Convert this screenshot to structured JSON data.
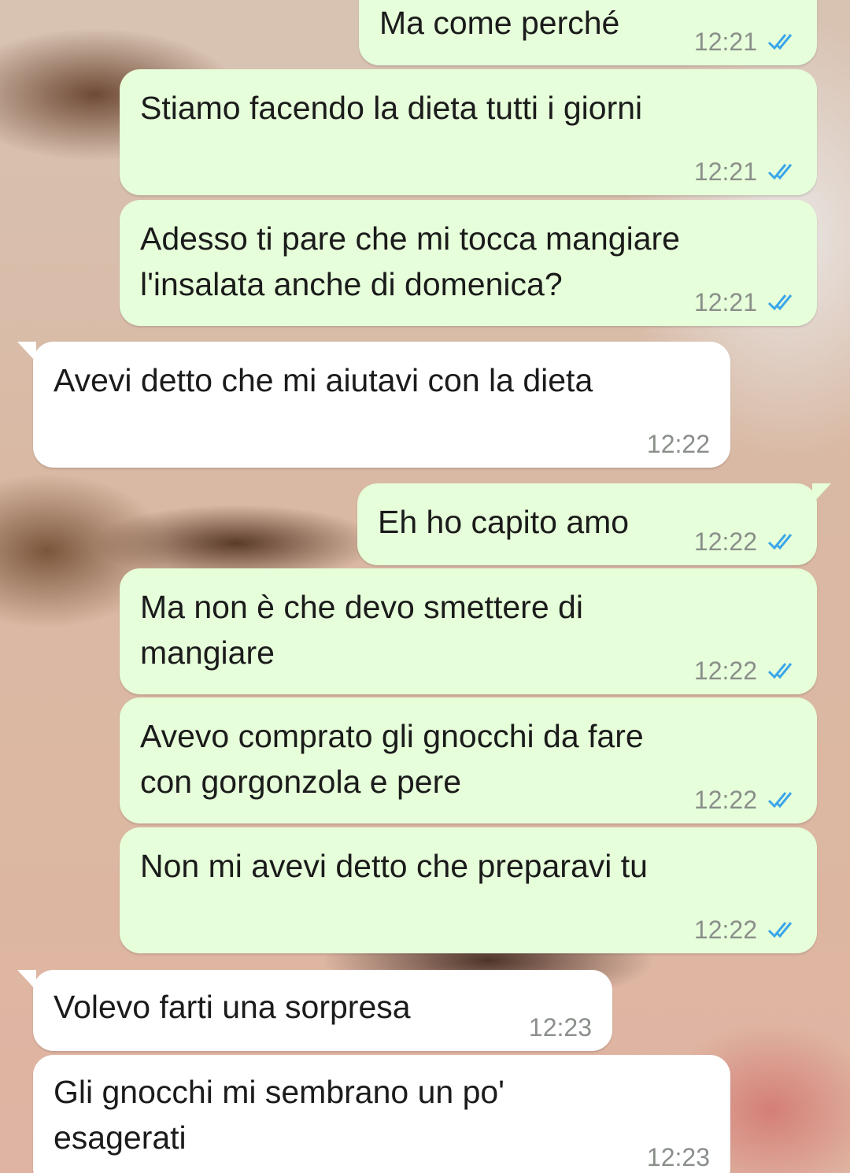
{
  "colors": {
    "outgoing_bubble": "#e6ffda",
    "incoming_bubble": "#ffffff",
    "read_tick": "#3ba6e8",
    "timestamp": "#8a8f8a"
  },
  "messages": [
    {
      "direction": "out",
      "text": "Ma come perché",
      "time": "12:21",
      "status_icon": "double-check-read-icon"
    },
    {
      "direction": "out",
      "text": "Stiamo facendo la dieta tutti i giorni",
      "time": "12:21",
      "status_icon": "double-check-read-icon"
    },
    {
      "direction": "out",
      "text": "Adesso ti pare che mi tocca mangiare\nl'insalata anche di domenica?",
      "time": "12:21",
      "status_icon": "double-check-read-icon"
    },
    {
      "direction": "in",
      "text": "Avevi detto che mi aiutavi con la dieta",
      "time": "12:22"
    },
    {
      "direction": "out",
      "text": "Eh ho capito amo",
      "time": "12:22",
      "status_icon": "double-check-read-icon"
    },
    {
      "direction": "out",
      "text": "Ma non è che devo smettere di\nmangiare",
      "time": "12:22",
      "status_icon": "double-check-read-icon"
    },
    {
      "direction": "out",
      "text": "Avevo comprato gli gnocchi da fare\ncon gorgonzola e pere",
      "time": "12:22",
      "status_icon": "double-check-read-icon"
    },
    {
      "direction": "out",
      "text": "Non mi avevi detto che preparavi tu",
      "time": "12:22",
      "status_icon": "double-check-read-icon"
    },
    {
      "direction": "in",
      "text": "Volevo farti una sorpresa",
      "time": "12:23"
    },
    {
      "direction": "in",
      "text": "Gli gnocchi mi sembrano un po'\nesagerati",
      "time": "12:23"
    }
  ]
}
